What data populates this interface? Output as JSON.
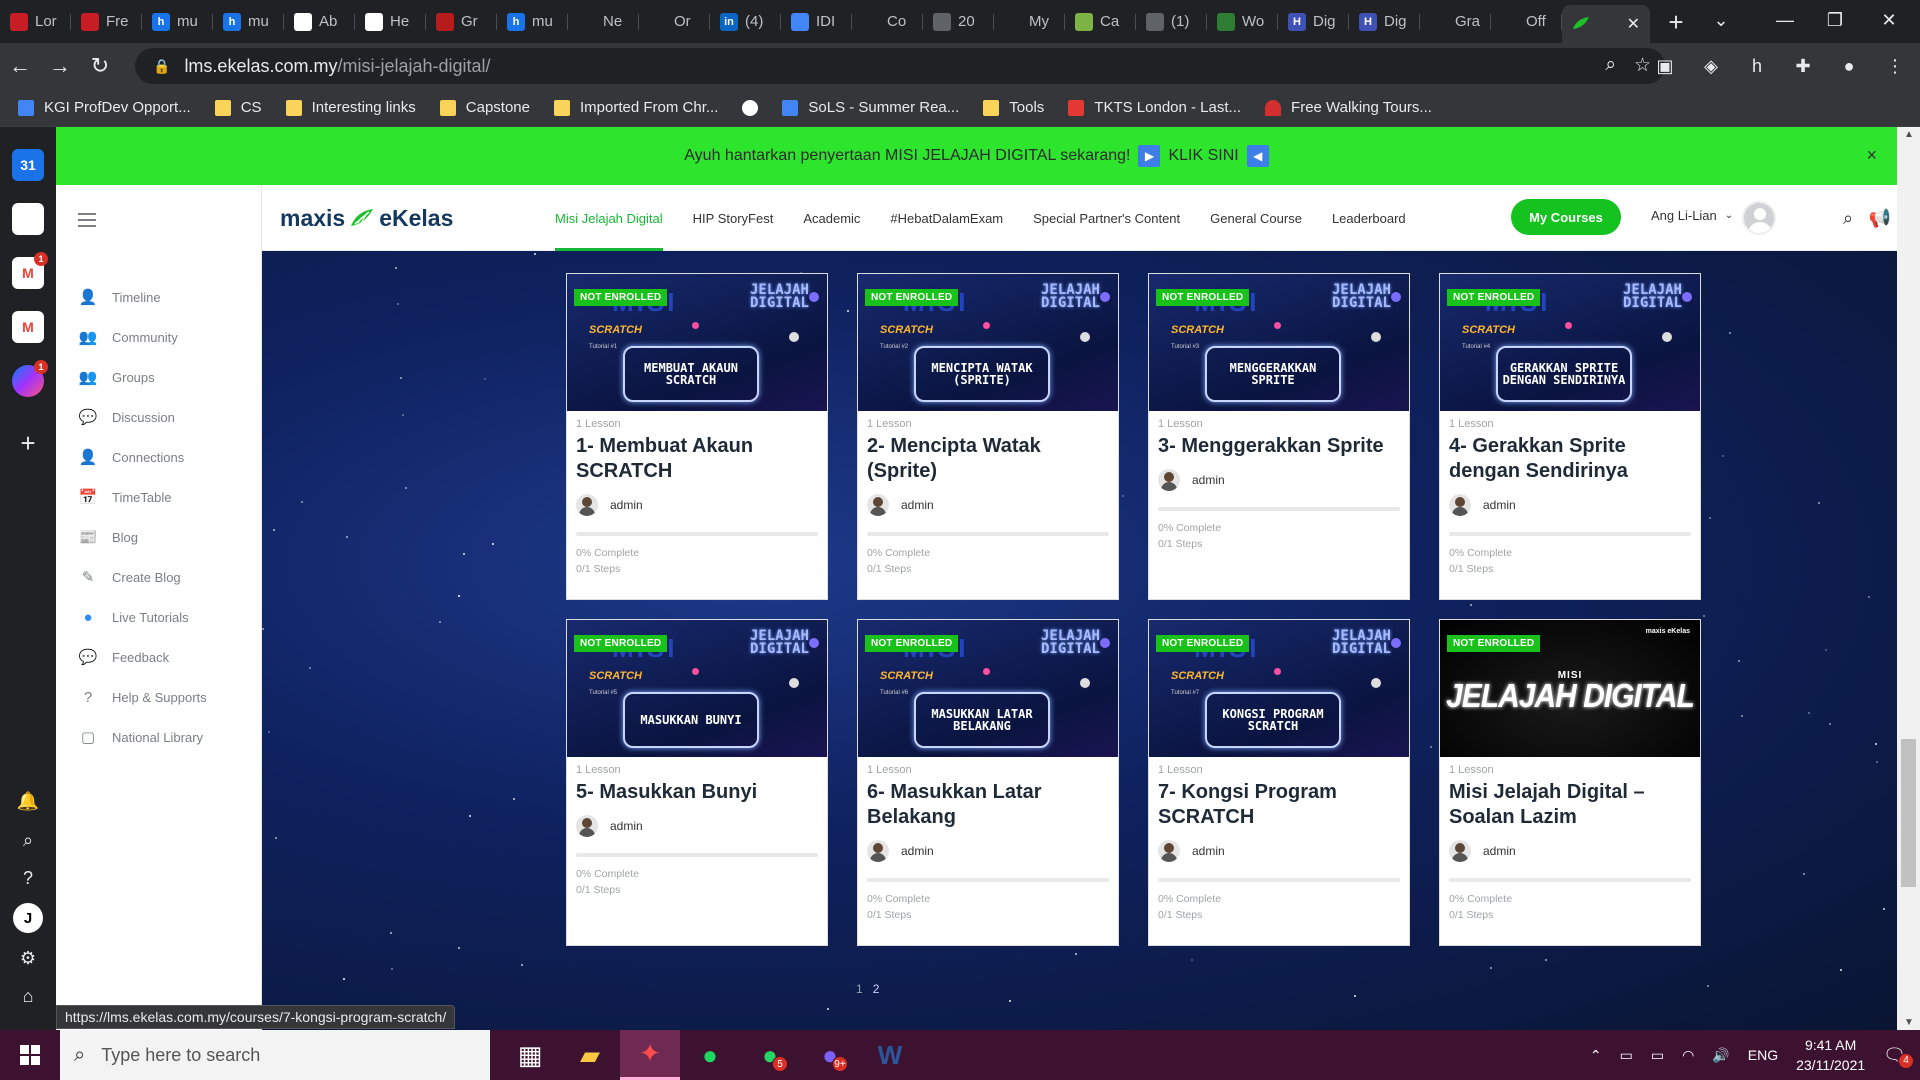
{
  "browser": {
    "tabs": [
      {
        "label": "Lor",
        "fav_color": "#c81d25",
        "fav_text": "",
        "icon": "tab-favicon-red"
      },
      {
        "label": "Fre",
        "fav_color": "#c81d25",
        "fav_text": "",
        "icon": "tab-favicon-red"
      },
      {
        "label": "mu",
        "fav_color": "#1a73e8",
        "fav_text": "h",
        "icon": "tab-favicon-h"
      },
      {
        "label": "mu",
        "fav_color": "#1a73e8",
        "fav_text": "h",
        "icon": "tab-favicon-h"
      },
      {
        "label": "Ab",
        "fav_color": "#ffffff",
        "fav_text": "",
        "icon": "tab-favicon-white"
      },
      {
        "label": "He",
        "fav_color": "#ffffff",
        "fav_text": "",
        "icon": "tab-favicon-white"
      },
      {
        "label": "Gr",
        "fav_color": "#b71c1c",
        "fav_text": "",
        "icon": "tab-favicon-mic"
      },
      {
        "label": "mu",
        "fav_color": "#1a73e8",
        "fav_text": "h",
        "icon": "tab-favicon-h"
      },
      {
        "label": "Ne",
        "fav_color": "#202124",
        "fav_text": "",
        "icon": "tab-favicon-nyt"
      },
      {
        "label": "Or",
        "fav_color": "#202124",
        "fav_text": "",
        "icon": "tab-favicon-grid"
      },
      {
        "label": "(4)",
        "fav_color": "#0a66c2",
        "fav_text": "in",
        "icon": "tab-favicon-linkedin"
      },
      {
        "label": "IDI",
        "fav_color": "#4285f4",
        "fav_text": "",
        "icon": "tab-favicon-doc"
      },
      {
        "label": "Co",
        "fav_color": "#202124",
        "fav_text": "",
        "icon": "tab-favicon-circle"
      },
      {
        "label": "20",
        "fav_color": "#5f6368",
        "fav_text": "",
        "icon": "tab-favicon-globe"
      },
      {
        "label": "My",
        "fav_color": "#202124",
        "fav_text": "",
        "icon": "tab-favicon-shield"
      },
      {
        "label": "Ca",
        "fav_color": "#7cb342",
        "fav_text": "",
        "icon": "tab-favicon-tree"
      },
      {
        "label": "(1)",
        "fav_color": "#5f6368",
        "fav_text": "",
        "icon": "tab-favicon-search"
      },
      {
        "label": "Wo",
        "fav_color": "#2e7d32",
        "fav_text": "",
        "icon": "tab-favicon-leaf"
      },
      {
        "label": "Dig",
        "fav_color": "#3f51b5",
        "fav_text": "H",
        "icon": "tab-favicon-h"
      },
      {
        "label": "Dig",
        "fav_color": "#3f51b5",
        "fav_text": "H",
        "icon": "tab-favicon-h"
      },
      {
        "label": "Gra",
        "fav_color": "#202124",
        "fav_text": "",
        "icon": "tab-favicon-circle"
      },
      {
        "label": "Off",
        "fav_color": "#202124",
        "fav_text": "",
        "icon": "tab-favicon-circle"
      }
    ],
    "active_tab": {
      "label": "",
      "icon": "maxis-leaf-icon"
    },
    "url_host": "lms.ekelas.com.my",
    "url_path": "/misi-jelajah-digital/",
    "bookmarks": [
      {
        "label": "KGI ProfDev Opport...",
        "type": "doc"
      },
      {
        "label": "CS",
        "type": "folder"
      },
      {
        "label": "Interesting links",
        "type": "folder"
      },
      {
        "label": "Capstone",
        "type": "folder"
      },
      {
        "label": "Imported From Chr...",
        "type": "folder"
      },
      {
        "label": "",
        "type": "globe"
      },
      {
        "label": "SoLS - Summer Rea...",
        "type": "doc"
      },
      {
        "label": "Tools",
        "type": "folder"
      },
      {
        "label": "TKTS London - Last...",
        "type": "tkts"
      },
      {
        "label": "Free Walking Tours...",
        "type": "umbrella"
      }
    ],
    "status_url": "https://lms.ekelas.com.my/courses/7-kongsi-program-scratch/"
  },
  "rail": {
    "apps": [
      {
        "name": "calendar",
        "text": "31",
        "color": "#1a73e8",
        "badge": ""
      },
      {
        "name": "notion",
        "text": "",
        "color": "#ffffff",
        "badge": ""
      },
      {
        "name": "gmail",
        "text": "M",
        "color": "#ea4335",
        "badge": "1"
      },
      {
        "name": "gmail",
        "text": "M",
        "color": "#ea4335",
        "badge": ""
      },
      {
        "name": "messenger",
        "text": "",
        "color": "#a334fa",
        "badge": "1"
      }
    ],
    "user_initial": "J"
  },
  "banner": {
    "text": "Ayuh hantarkan penyertaan MISI JELAJAH DIGITAL sekarang!",
    "cta": "KLIK SINI",
    "close": "×"
  },
  "sidebar": {
    "items": [
      {
        "label": "Timeline",
        "icon": "user-icon",
        "glyph": "👤"
      },
      {
        "label": "Community",
        "icon": "community-icon",
        "glyph": "👥"
      },
      {
        "label": "Groups",
        "icon": "groups-icon",
        "glyph": "👥"
      },
      {
        "label": "Discussion",
        "icon": "discussion-icon",
        "glyph": "💬"
      },
      {
        "label": "Connections",
        "icon": "connections-icon",
        "glyph": "👤"
      },
      {
        "label": "TimeTable",
        "icon": "calendar-icon",
        "glyph": "📅"
      },
      {
        "label": "Blog",
        "icon": "blog-icon",
        "glyph": "📰"
      },
      {
        "label": "Create Blog",
        "icon": "edit-icon",
        "glyph": "✎"
      },
      {
        "label": "Live Tutorials",
        "icon": "zoom-icon",
        "glyph": "●"
      },
      {
        "label": "Feedback",
        "icon": "feedback-icon",
        "glyph": "💬"
      },
      {
        "label": "Help & Supports",
        "icon": "help-icon",
        "glyph": "?"
      },
      {
        "label": "National Library",
        "icon": "library-icon",
        "glyph": "▢"
      }
    ]
  },
  "header": {
    "logo_maxis": "maxis",
    "logo_ekelas": "eKelas",
    "nav": [
      {
        "label": "Misi Jelajah Digital",
        "active": true
      },
      {
        "label": "HIP StoryFest",
        "active": false
      },
      {
        "label": "Academic",
        "active": false
      },
      {
        "label": "#HebatDalamExam",
        "active": false
      },
      {
        "label": "Special Partner's Content",
        "active": false
      },
      {
        "label": "General Course",
        "active": false
      },
      {
        "label": "Leaderboard",
        "active": false
      }
    ],
    "my_courses": "My Courses",
    "user_name": "Ang Li-Lian"
  },
  "courses": [
    {
      "badge": "NOT ENROLLED",
      "lessons": "1 Lesson",
      "title": "1- Membuat Akaun SCRATCH",
      "author": "admin",
      "complete": "0% Complete",
      "steps": "0/1 Steps",
      "thumb_title": "MEMBUAT AKAUN SCRATCH",
      "tutorial": "Tutorial #1",
      "style": "space"
    },
    {
      "badge": "NOT ENROLLED",
      "lessons": "1 Lesson",
      "title": "2- Mencipta Watak (Sprite)",
      "author": "admin",
      "complete": "0% Complete",
      "steps": "0/1 Steps",
      "thumb_title": "MENCIPTA WATAK (SPRITE)",
      "tutorial": "Tutorial #2",
      "style": "space"
    },
    {
      "badge": "NOT ENROLLED",
      "lessons": "1 Lesson",
      "title": "3- Menggerakkan Sprite",
      "author": "admin",
      "complete": "0% Complete",
      "steps": "0/1 Steps",
      "thumb_title": "MENGGERAKKAN SPRITE",
      "tutorial": "Tutorial #3",
      "style": "space"
    },
    {
      "badge": "NOT ENROLLED",
      "lessons": "1 Lesson",
      "title": "4- Gerakkan Sprite dengan Sendirinya",
      "author": "admin",
      "complete": "0% Complete",
      "steps": "0/1 Steps",
      "thumb_title": "GERAKKAN SPRITE DENGAN SENDIRINYA",
      "tutorial": "Tutorial #4",
      "style": "space"
    },
    {
      "badge": "NOT ENROLLED",
      "lessons": "1 Lesson",
      "title": "5- Masukkan Bunyi",
      "author": "admin",
      "complete": "0% Complete",
      "steps": "0/1 Steps",
      "thumb_title": "MASUKKAN BUNYI",
      "tutorial": "Tutorial #5",
      "style": "space"
    },
    {
      "badge": "NOT ENROLLED",
      "lessons": "1 Lesson",
      "title": "6- Masukkan Latar Belakang",
      "author": "admin",
      "complete": "0% Complete",
      "steps": "0/1 Steps",
      "thumb_title": "MASUKKAN LATAR BELAKANG",
      "tutorial": "Tutorial #6",
      "style": "space"
    },
    {
      "badge": "NOT ENROLLED",
      "lessons": "1 Lesson",
      "title": "7- Kongsi Program SCRATCH",
      "author": "admin",
      "complete": "0% Complete",
      "steps": "0/1 Steps",
      "thumb_title": "KONGSI PROGRAM SCRATCH",
      "tutorial": "Tutorial #7",
      "style": "space"
    },
    {
      "badge": "NOT ENROLLED",
      "lessons": "1 Lesson",
      "title": "Misi Jelajah Digital – Soalan Lazim",
      "author": "admin",
      "complete": "0% Complete",
      "steps": "0/1 Steps",
      "thumb_title": "JELAJAH DIGITAL",
      "thumb_misi": "MISI",
      "thumb_brand": "maxis eKelas",
      "style": "dark"
    }
  ],
  "thumb_common": {
    "misi": "MISI",
    "jelajah": "JELAJAH",
    "digital": "DIGITAL",
    "scratch": "SCRATCH"
  },
  "pagination": [
    "1",
    "2"
  ],
  "taskbar": {
    "search_placeholder": "Type here to search",
    "apps": [
      {
        "name": "task-view",
        "badge": ""
      },
      {
        "name": "file-explorer",
        "badge": ""
      },
      {
        "name": "app-red",
        "badge": "",
        "active": true
      },
      {
        "name": "spotify",
        "badge": ""
      },
      {
        "name": "whatsapp",
        "badge": "5"
      },
      {
        "name": "messenger",
        "badge": "9+"
      },
      {
        "name": "word",
        "badge": ""
      }
    ],
    "lang": "ENG",
    "time": "9:41 AM",
    "date": "23/11/2021",
    "notif_count": "4"
  },
  "colors": {
    "accent_green": "#17b835",
    "banner_green": "#2ee52e",
    "badge_green": "#18c21a",
    "navy": "#14385f"
  }
}
